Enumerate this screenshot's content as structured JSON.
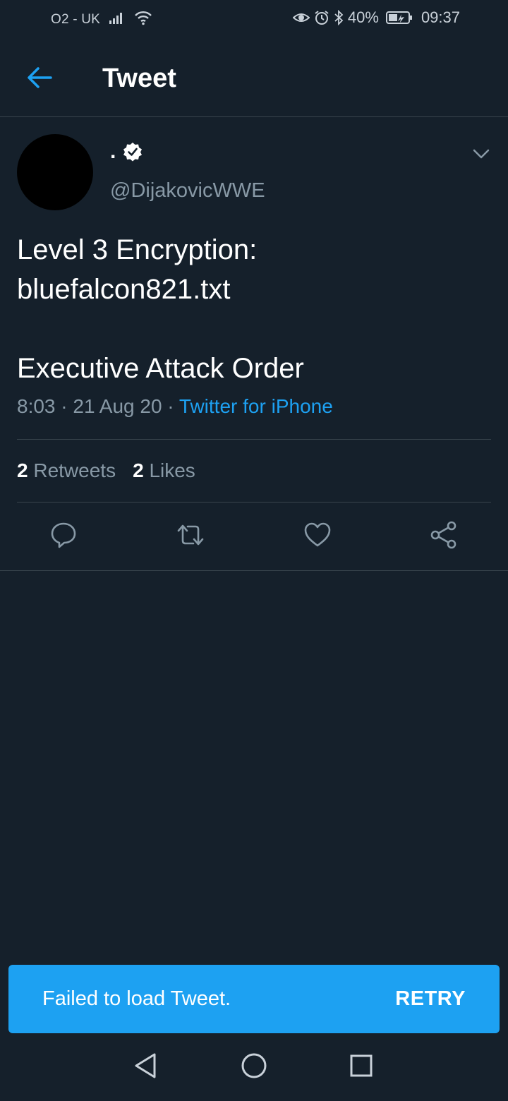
{
  "status_bar": {
    "carrier": "O2 - UK",
    "battery_percent": "40%",
    "time": "09:37",
    "icons": [
      "signal-icon",
      "wifi-icon",
      "eye-icon",
      "alarm-icon",
      "bluetooth-icon",
      "battery-icon"
    ]
  },
  "header": {
    "title": "Tweet",
    "back_icon": "back-arrow-icon"
  },
  "tweet": {
    "display_name": ".",
    "verified": true,
    "handle": "@DijakovicWWE",
    "text_lines": [
      "Level 3 Encryption:",
      "bluefalcon821.txt",
      "",
      "Executive Attack Order"
    ],
    "time": "8:03",
    "date": "21 Aug 20",
    "separator": "·",
    "source": "Twitter for iPhone",
    "retweets_count": "2",
    "retweets_label": "Retweets",
    "likes_count": "2",
    "likes_label": "Likes"
  },
  "actions": [
    "reply-icon",
    "retweet-icon",
    "like-icon",
    "share-icon"
  ],
  "snackbar": {
    "message": "Failed to load Tweet.",
    "action_label": "RETRY"
  },
  "colors": {
    "background": "#15202b",
    "accent": "#1da1f2",
    "muted": "#8899a6",
    "divider": "#38444d"
  }
}
